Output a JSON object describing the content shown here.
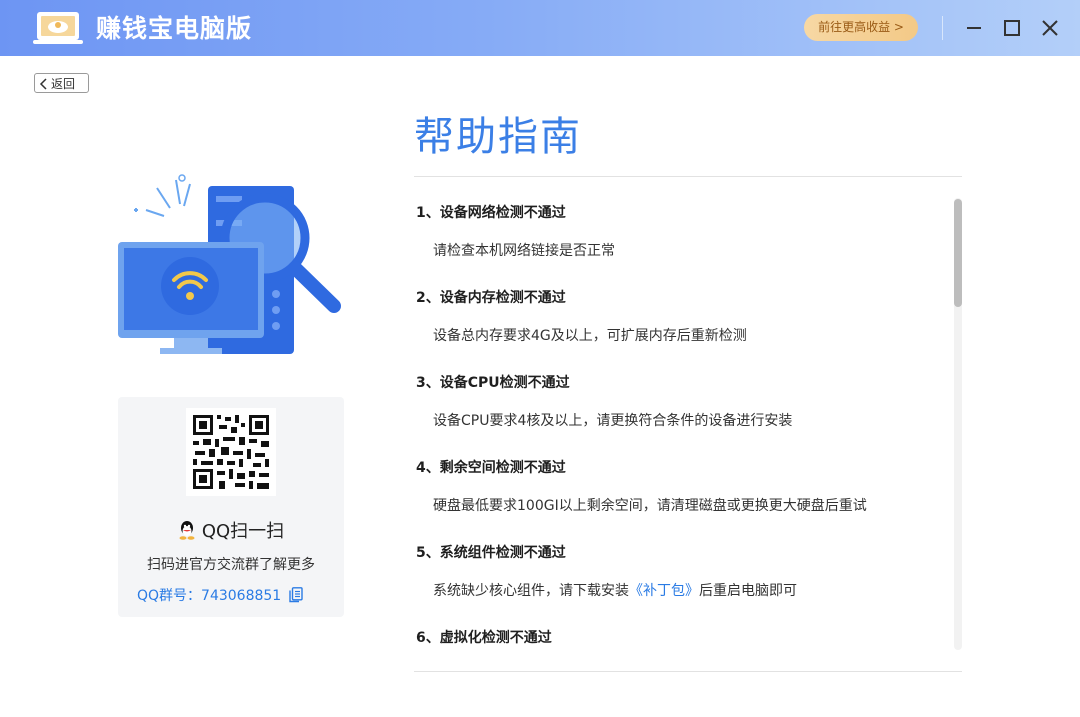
{
  "app": {
    "title": "赚钱宝电脑版",
    "promo_label": "前往更高收益 >"
  },
  "nav": {
    "back_label": "返回"
  },
  "qr": {
    "scan_title": "QQ扫一扫",
    "description": "扫码进官方交流群了解更多",
    "group_label": "QQ群号：743068851"
  },
  "help": {
    "title": "帮助指南",
    "items": [
      {
        "title": "1、设备网络检测不通过",
        "desc": "请检查本机网络链接是否正常"
      },
      {
        "title": "2、设备内存检测不通过",
        "desc": "设备总内存要求4G及以上，可扩展内存后重新检测"
      },
      {
        "title": "3、设备CPU检测不通过",
        "desc": "设备CPU要求4核及以上，请更换符合条件的设备进行安装"
      },
      {
        "title": "4、剩余空间检测不通过",
        "desc": "硬盘最低要求100GI以上剩余空间，请清理磁盘或更换更大硬盘后重试"
      },
      {
        "title": "5、系统组件检测不通过",
        "desc_before": "系统缺少核心组件，请下载安装",
        "link": "《补丁包》",
        "desc_after": "后重启电脑即可"
      },
      {
        "title": "6、虚拟化检测不通过"
      }
    ]
  },
  "colors": {
    "accent": "#3b7fe6",
    "link": "#2a7be4",
    "titlebar_start": "#6d95f3",
    "titlebar_end": "#b3cff9",
    "promo": "#f3c987"
  },
  "icons": [
    "app-logo-icon",
    "minimize-icon",
    "maximize-icon",
    "close-icon",
    "chevron-left-icon",
    "qq-penguin-icon",
    "copy-icon"
  ]
}
